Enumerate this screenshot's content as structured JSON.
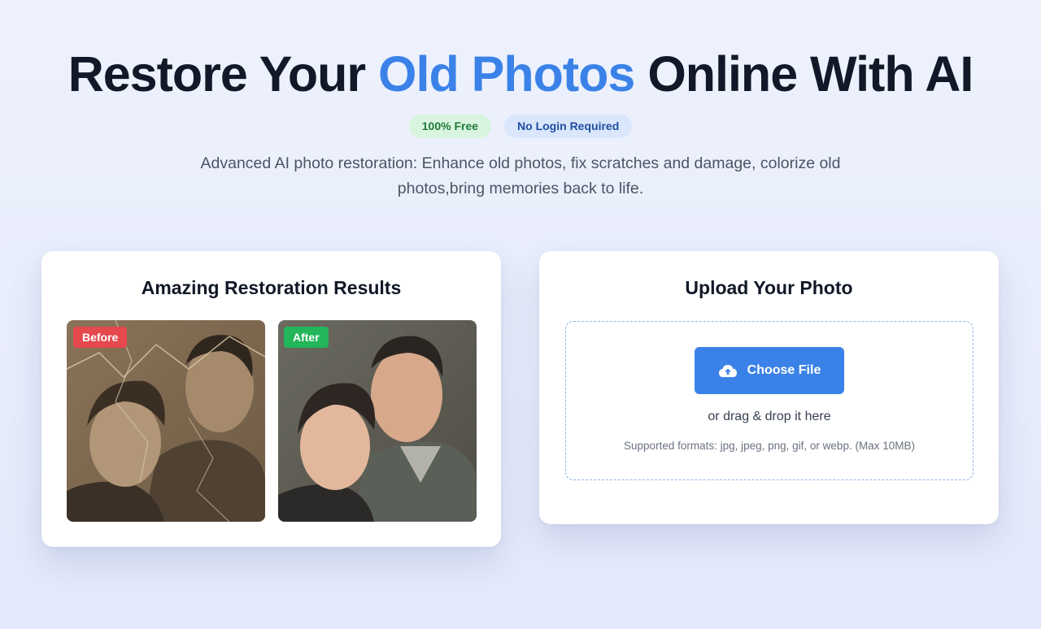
{
  "hero": {
    "title_prefix": "Restore Your ",
    "title_accent": "Old Photos",
    "title_suffix": " Online With AI",
    "badges": [
      {
        "label": "100% Free"
      },
      {
        "label": "No Login Required"
      }
    ],
    "subtitle": "Advanced AI photo restoration: Enhance old photos, fix scratches and damage, colorize old photos,bring memories back to life."
  },
  "results": {
    "title": "Amazing Restoration Results",
    "before_label": "Before",
    "after_label": "After"
  },
  "upload": {
    "title": "Upload Your Photo",
    "choose_label": "Choose File",
    "drag_text": "or drag & drop it here",
    "formats_text": "Supported formats: jpg, jpeg, png, gif, or webp. (Max 10MB)",
    "icon": "cloud-upload-icon"
  },
  "colors": {
    "accent": "#3b82e8",
    "before_tag": "#e5484d",
    "after_tag": "#22b55a"
  }
}
